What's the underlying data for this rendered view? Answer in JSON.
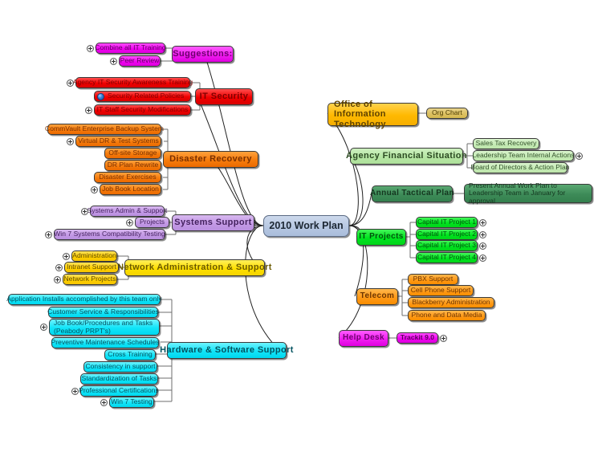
{
  "document": {
    "type": "mind-map",
    "title": "2010 Work Plan"
  },
  "central": {
    "label": "2010 Work Plan",
    "color": "#b7c8e2"
  },
  "branches": [
    {
      "id": "suggestions",
      "label": "Suggestions:",
      "color": "#f01ef0",
      "side": "left",
      "children": [
        {
          "label": "Combine all IT Training",
          "expander": "plus"
        },
        {
          "label": "Peer Review",
          "expander": "plus"
        }
      ]
    },
    {
      "id": "it-security",
      "label": "IT Security",
      "color": "#f00000",
      "side": "left",
      "children": [
        {
          "label": "Agency IT Security Awareness Training",
          "expander": "plus"
        },
        {
          "label": "Security Related Policies",
          "icon": "globe-icon"
        },
        {
          "label": "IT Staff Security Modifications",
          "expander": "plus"
        }
      ]
    },
    {
      "id": "disaster-recovery",
      "label": "Disaster Recovery",
      "color": "#f57c0d",
      "side": "left",
      "children": [
        {
          "label": "CommVault Enterprise Backup System"
        },
        {
          "label": "Virtual DR & Test Systems",
          "expander": "plus"
        },
        {
          "label": "Off-site Storage"
        },
        {
          "label": "DR Plan Rewrite"
        },
        {
          "label": "Disaster Exercises"
        },
        {
          "label": "Job Book Location",
          "expander": "plus"
        }
      ]
    },
    {
      "id": "systems-support",
      "label": "Systems Support",
      "color": "#c49ae6",
      "side": "left",
      "children": [
        {
          "label": "Systems Admin & Support",
          "expander": "plus"
        },
        {
          "label": "Projects",
          "expander": "plus"
        },
        {
          "label": "Win 7 Systems Compatibility Testing",
          "expander": "plus"
        }
      ]
    },
    {
      "id": "network-administration",
      "label": "Network Administration & Support",
      "color": "#ffe000",
      "side": "left",
      "children": [
        {
          "label": "Administration",
          "expander": "circle"
        },
        {
          "label": "Intranet Support",
          "expander": "circle"
        },
        {
          "label": "Network Projects",
          "expander": "circle"
        }
      ]
    },
    {
      "id": "hardware-software-support",
      "label": "Hardware & Software Support",
      "color": "#12e4f8",
      "side": "left",
      "children": [
        {
          "label": "Application Installs accomplished by this team only"
        },
        {
          "label": "Customer Service & Responsibilities"
        },
        {
          "label": "Job Book/Procedures and Tasks (Peabody PRPT's)",
          "expander": "circle",
          "multiline": true
        },
        {
          "label": "Preventive Maintenance Schedules"
        },
        {
          "label": "Cross Training"
        },
        {
          "label": "Consistency in support"
        },
        {
          "label": "Standardization of Tasks"
        },
        {
          "label": "Professional Certifications",
          "expander": "circle"
        },
        {
          "label": "Win 7 Testing",
          "expander": "circle"
        }
      ]
    },
    {
      "id": "office-of-information-technology",
      "label": "Office of Information Technology",
      "color": "#ffb900",
      "side": "right",
      "children": [
        {
          "label": "Org Chart"
        }
      ]
    },
    {
      "id": "agency-financial-situation",
      "label": "Agency Financial Situation",
      "color": "#b6e6a4",
      "side": "right",
      "children": [
        {
          "label": "Sales Tax Recovery"
        },
        {
          "label": "Leadership Team Internal Actions",
          "expander": "circle-right"
        },
        {
          "label": "Board of Directors & Action Plan"
        }
      ]
    },
    {
      "id": "annual-tactical-plan",
      "label": "Annual Tactical Plan",
      "color": "#3d8b58",
      "side": "right",
      "children": [
        {
          "label": "Present Annual Work Plan to Leadership Team in January for approval",
          "multiline": true
        }
      ]
    },
    {
      "id": "it-projects",
      "label": "IT Projects",
      "color": "#00e41f",
      "side": "right",
      "children": [
        {
          "label": "Capital IT Project 1",
          "expander": "circle-right"
        },
        {
          "label": "Capital IT Project 2",
          "expander": "circle-right"
        },
        {
          "label": "Capital IT Project 3",
          "expander": "circle-right"
        },
        {
          "label": "Capital IT Project 4",
          "expander": "circle-right"
        }
      ]
    },
    {
      "id": "telecom",
      "label": "Telecom",
      "color": "#ff9a18",
      "side": "right",
      "children": [
        {
          "label": "PBX Support"
        },
        {
          "label": "Cell Phone Support"
        },
        {
          "label": "Blackberry Administration"
        },
        {
          "label": "Phone and Data Media"
        }
      ]
    },
    {
      "id": "help-desk",
      "label": "Help Desk",
      "color": "#f01ef0",
      "side": "right",
      "children": [
        {
          "label": "Trackit 9.0",
          "expander": "circle-right"
        }
      ]
    }
  ]
}
